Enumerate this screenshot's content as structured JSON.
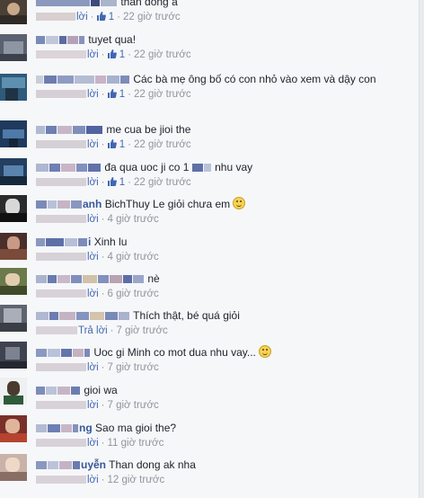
{
  "comments": [
    {
      "name": "",
      "text": "thần đồng à",
      "reply": "lời",
      "likes": "1",
      "time": "22 giờ trước",
      "emoji": false
    },
    {
      "name": "",
      "text": "tuyet qua!",
      "reply": "lời",
      "likes": "1",
      "time": "22 giờ trước",
      "emoji": false
    },
    {
      "name": "",
      "text": "Các bà mẹ ông bố có con nhỏ vào xem và dậy con",
      "reply": "lời",
      "likes": "1",
      "time": "22 giờ trước",
      "emoji": false
    },
    {
      "name": "",
      "text": "me cua be jioi the",
      "reply": "lời",
      "likes": "1",
      "time": "22 giờ trước",
      "emoji": false
    },
    {
      "name": "",
      "text": "đa qua uoc ji co 1",
      "text2": "nhu vay",
      "reply": "lời",
      "likes": "1",
      "time": "22 giờ trước",
      "emoji": false
    },
    {
      "name": "anh",
      "text": "BichThuy Le giỏi chưa em",
      "reply": "lời",
      "likes": "",
      "time": "4 giờ trước",
      "emoji": true
    },
    {
      "name": "i",
      "text": "Xinh lu",
      "reply": "lời",
      "likes": "",
      "time": "4 giờ trước",
      "emoji": false
    },
    {
      "name": "",
      "text": "nè",
      "reply": "lời",
      "likes": "",
      "time": "6 giờ trước",
      "emoji": false
    },
    {
      "name": "",
      "text": "Thích thật, bé quá giỏi",
      "reply": "Trả lời",
      "likes": "",
      "time": "7 giờ trước",
      "emoji": false
    },
    {
      "name": "",
      "text": "Uoc gi Minh co mot dua nhu vay...",
      "reply": "lời",
      "likes": "",
      "time": "7 giờ trước",
      "emoji": true
    },
    {
      "name": "",
      "text": "gioi wa",
      "reply": "lời",
      "likes": "",
      "time": "7 giờ trước",
      "emoji": false
    },
    {
      "name": "ng",
      "text": "Sao ma gioi the?",
      "reply": "lời",
      "likes": "",
      "time": "11 giờ trước",
      "emoji": false
    },
    {
      "name": "uyễn",
      "text": "Than dong ak nha",
      "reply": "lời",
      "likes": "",
      "time": "12 giờ trước",
      "emoji": false
    }
  ],
  "colors": {
    "link": "#4267b2",
    "name": "#365899",
    "meta": "#90949c",
    "background": "#f6f7f9"
  },
  "icons": {
    "like": "thumbs-up-icon",
    "emoji": "smiley-emoji-icon"
  }
}
